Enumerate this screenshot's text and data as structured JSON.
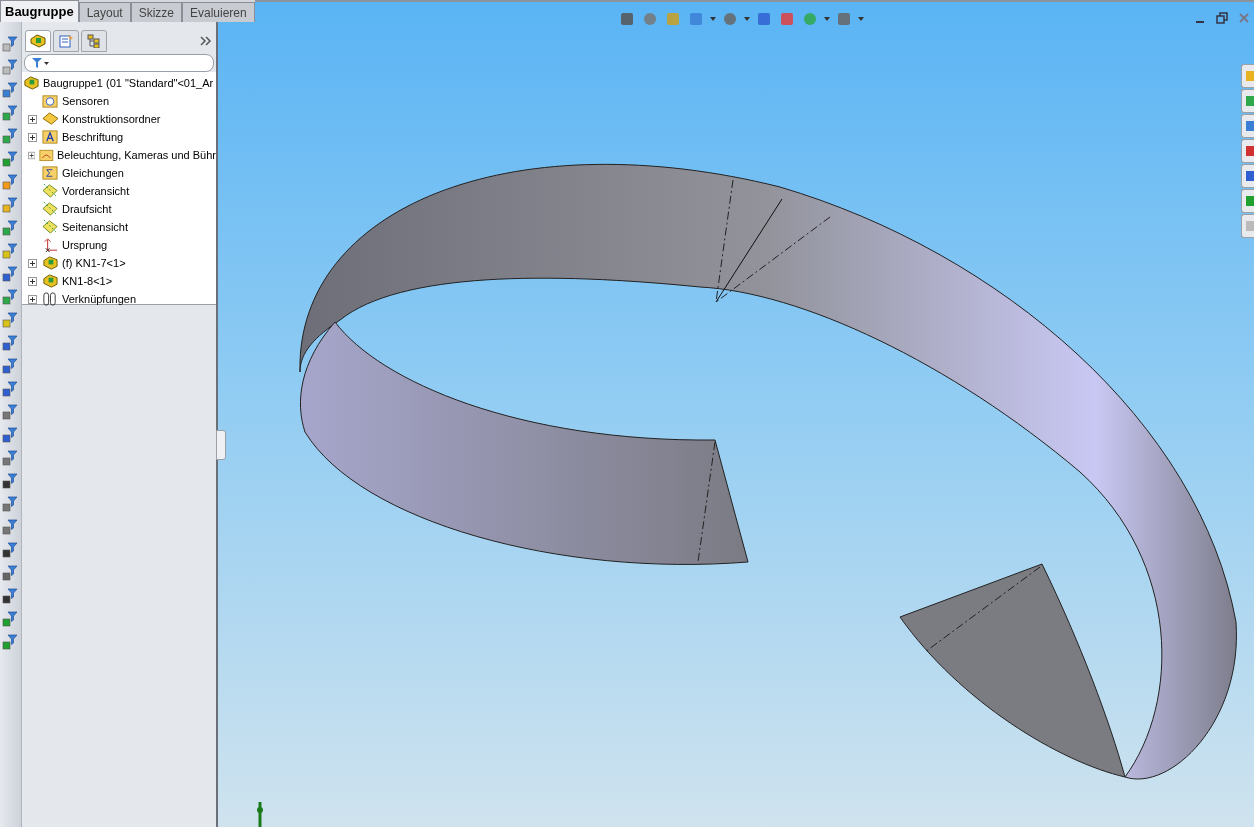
{
  "tabs": [
    {
      "label": "Baugruppe",
      "selected": true
    },
    {
      "label": "Layout",
      "selected": false
    },
    {
      "label": "Skizze",
      "selected": false
    },
    {
      "label": "Evaluieren",
      "selected": false
    }
  ],
  "panel_tabs": [
    {
      "kind": "tree",
      "selected": true
    },
    {
      "kind": "properties",
      "selected": false
    },
    {
      "kind": "config",
      "selected": false
    }
  ],
  "tree": {
    "label": "Baugruppe1  (01 \"Standard\"<01_Ar",
    "kind": "assembly",
    "children": [
      {
        "label": "Sensoren",
        "kind": "sensor",
        "collapsed": false
      },
      {
        "label": "Konstruktionsordner",
        "kind": "design",
        "collapsed": true
      },
      {
        "label": "Beschriftung",
        "kind": "annotation",
        "collapsed": true
      },
      {
        "label": "Beleuchtung, Kameras und Bühr",
        "kind": "lights",
        "collapsed": true
      },
      {
        "label": "Gleichungen",
        "kind": "equation",
        "collapsed": false
      },
      {
        "label": "Vorderansicht",
        "kind": "plane",
        "collapsed": false
      },
      {
        "label": "Draufsicht",
        "kind": "plane",
        "collapsed": false
      },
      {
        "label": "Seitenansicht",
        "kind": "plane",
        "collapsed": false
      },
      {
        "label": "Ursprung",
        "kind": "origin",
        "collapsed": false
      },
      {
        "label": "(f) KN1-7<1>",
        "kind": "part",
        "collapsed": true
      },
      {
        "label": "KN1-8<1>",
        "kind": "part",
        "collapsed": true
      },
      {
        "label": "Verknüpfungen",
        "kind": "mates",
        "collapsed": true
      }
    ]
  }
}
